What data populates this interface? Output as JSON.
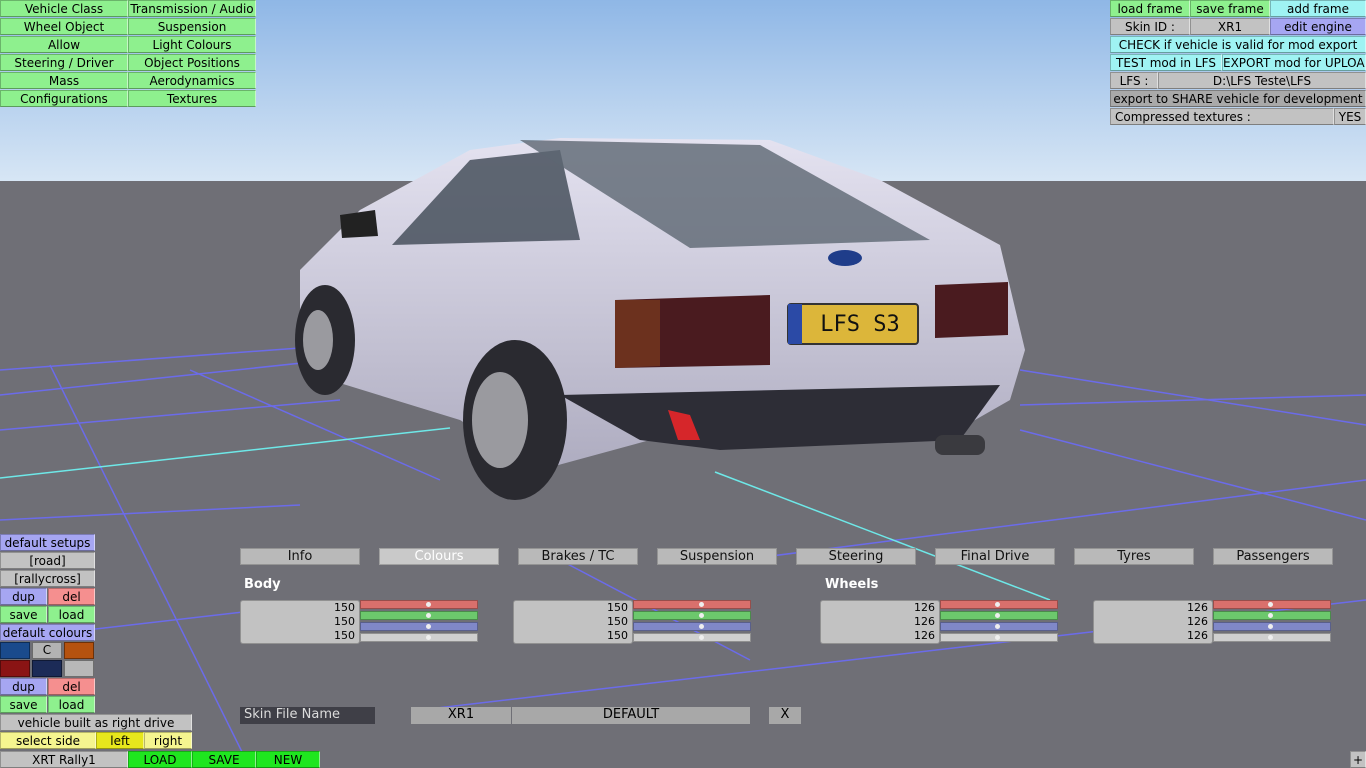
{
  "top_left_menu": {
    "col1": [
      "Vehicle Class",
      "Wheel Object",
      "Allow",
      "Steering / Driver",
      "Mass",
      "Configurations"
    ],
    "col2": [
      "Transmission / Audio",
      "Suspension",
      "Light Colours",
      "Object Positions",
      "Aerodynamics",
      "Textures"
    ]
  },
  "top_right": {
    "load_frame": "load frame",
    "save_frame": "save frame",
    "add_frame": "add frame",
    "skin_id_label": "Skin ID :",
    "skin_id_value": "XR1",
    "edit_engine": "edit engine",
    "check_valid": "CHECK if vehicle is valid for mod export",
    "test_mod": "TEST mod in LFS",
    "export_mod": "EXPORT mod for UPLOAD",
    "lfs_label": "LFS :",
    "lfs_path": "D:\\LFS Teste\\LFS",
    "export_share": "export to SHARE vehicle for development",
    "compressed_label": "Compressed textures :",
    "compressed_value": "YES"
  },
  "license_plate": "LFS S3",
  "tabs": [
    "Info",
    "Colours",
    "Brakes / TC",
    "Suspension",
    "Steering",
    "Final Drive",
    "Tyres",
    "Passengers"
  ],
  "active_tab": "Colours",
  "body_label": "Body",
  "wheels_label": "Wheels",
  "body_colours": [
    {
      "r": 150,
      "g": 150,
      "b": 150
    },
    {
      "r": 150,
      "g": 150,
      "b": 150
    }
  ],
  "wheel_colours": [
    {
      "r": 126,
      "g": 126,
      "b": 126
    },
    {
      "r": 126,
      "g": 126,
      "b": 126
    }
  ],
  "skin": {
    "label": "Skin File Name",
    "id": "XR1",
    "name": "DEFAULT",
    "close": "X"
  },
  "left_panel": {
    "default_setups": "default setups",
    "road": "[road]",
    "rallycross": "[rallycross]",
    "dup": "dup",
    "del": "del",
    "save": "save",
    "load": "load",
    "default_colours": "default colours",
    "swatch_c": "C",
    "right_drive": "vehicle built as right drive",
    "select_side": "select side",
    "left": "left",
    "right": "right",
    "vehicle_name": "XRT Rally1",
    "load_btn": "LOAD",
    "save_btn": "SAVE",
    "new_btn": "NEW"
  },
  "corner_plus": "+",
  "colors": {
    "slider_red": "#d9706c",
    "slider_green": "#6cc86c",
    "slider_blue": "#8088c8",
    "slider_gray": "#cfcfcf",
    "swatches": [
      "#1a4a8c",
      "#b3b3b3",
      "#b5520f",
      "#8a1414",
      "#1c2b57",
      "#b8b8b8"
    ]
  }
}
